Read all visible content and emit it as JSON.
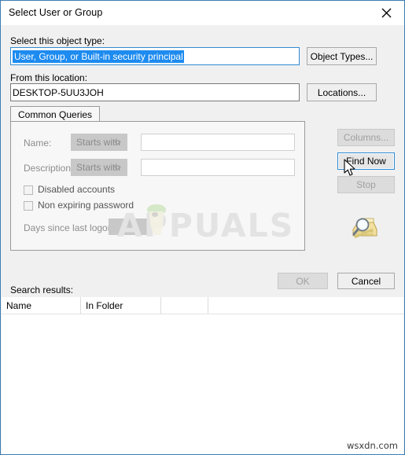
{
  "window": {
    "title": "Select User or Group",
    "close_icon": "close-icon"
  },
  "object_type": {
    "label": "Select this object type:",
    "value": "User, Group, or Built-in security principal",
    "button_label": "Object Types..."
  },
  "location": {
    "label": "From this location:",
    "value": "DESKTOP-5UU3JOH",
    "button_label": "Locations..."
  },
  "tabs": [
    {
      "label": "Common Queries",
      "selected": true
    }
  ],
  "query": {
    "name": {
      "label": "Name:",
      "operator": "Starts with",
      "value": "",
      "placeholder": ""
    },
    "description": {
      "label": "Description:",
      "operator": "Starts with",
      "value": "",
      "placeholder": ""
    },
    "disabled_accounts": {
      "label": "Disabled accounts",
      "checked": false
    },
    "non_expiring_password": {
      "label": "Non expiring password",
      "checked": false
    },
    "days_since_last_logon": {
      "label": "Days since last logon:",
      "value": ""
    }
  },
  "side_buttons": {
    "columns": "Columns...",
    "find_now": "Find Now",
    "stop": "Stop",
    "search_icon": "magnifier-folder-icon"
  },
  "footer": {
    "ok": "OK",
    "cancel": "Cancel"
  },
  "results": {
    "label": "Search results:",
    "columns": [
      "Name",
      "In Folder",
      ""
    ],
    "rows": []
  },
  "watermarks": {
    "center": "APPUALS",
    "corner": "wsxdn.com"
  },
  "colors": {
    "window_border": "#3b7cb5",
    "selection_blue": "#1d8bf0",
    "focus_blue": "#2f8ad4",
    "dialog_bg": "#f0f0f0"
  }
}
